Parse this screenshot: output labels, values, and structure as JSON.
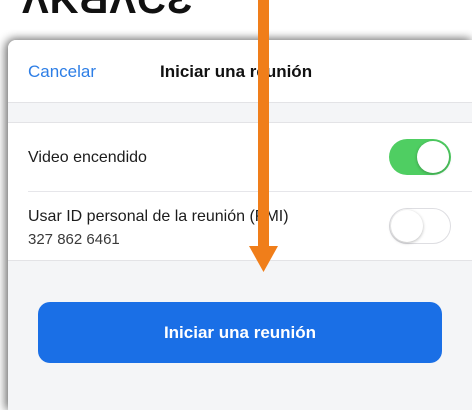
{
  "top_partial_text": "ɅƘƋɅƇƐ",
  "header": {
    "cancel_label": "Cancelar",
    "title": "Iniciar una reunión"
  },
  "settings": {
    "video": {
      "label": "Video encendido",
      "enabled": true
    },
    "pmi": {
      "label": "Usar ID personal de la reunión (PMI)",
      "id": "327 862 6461",
      "enabled": false
    }
  },
  "start_button_label": "Iniciar una reunión",
  "colors": {
    "accent": "#2d7ee6",
    "button": "#1a6fe6",
    "toggle_on": "#4fce62",
    "annotation_arrow": "#f07e1a"
  }
}
